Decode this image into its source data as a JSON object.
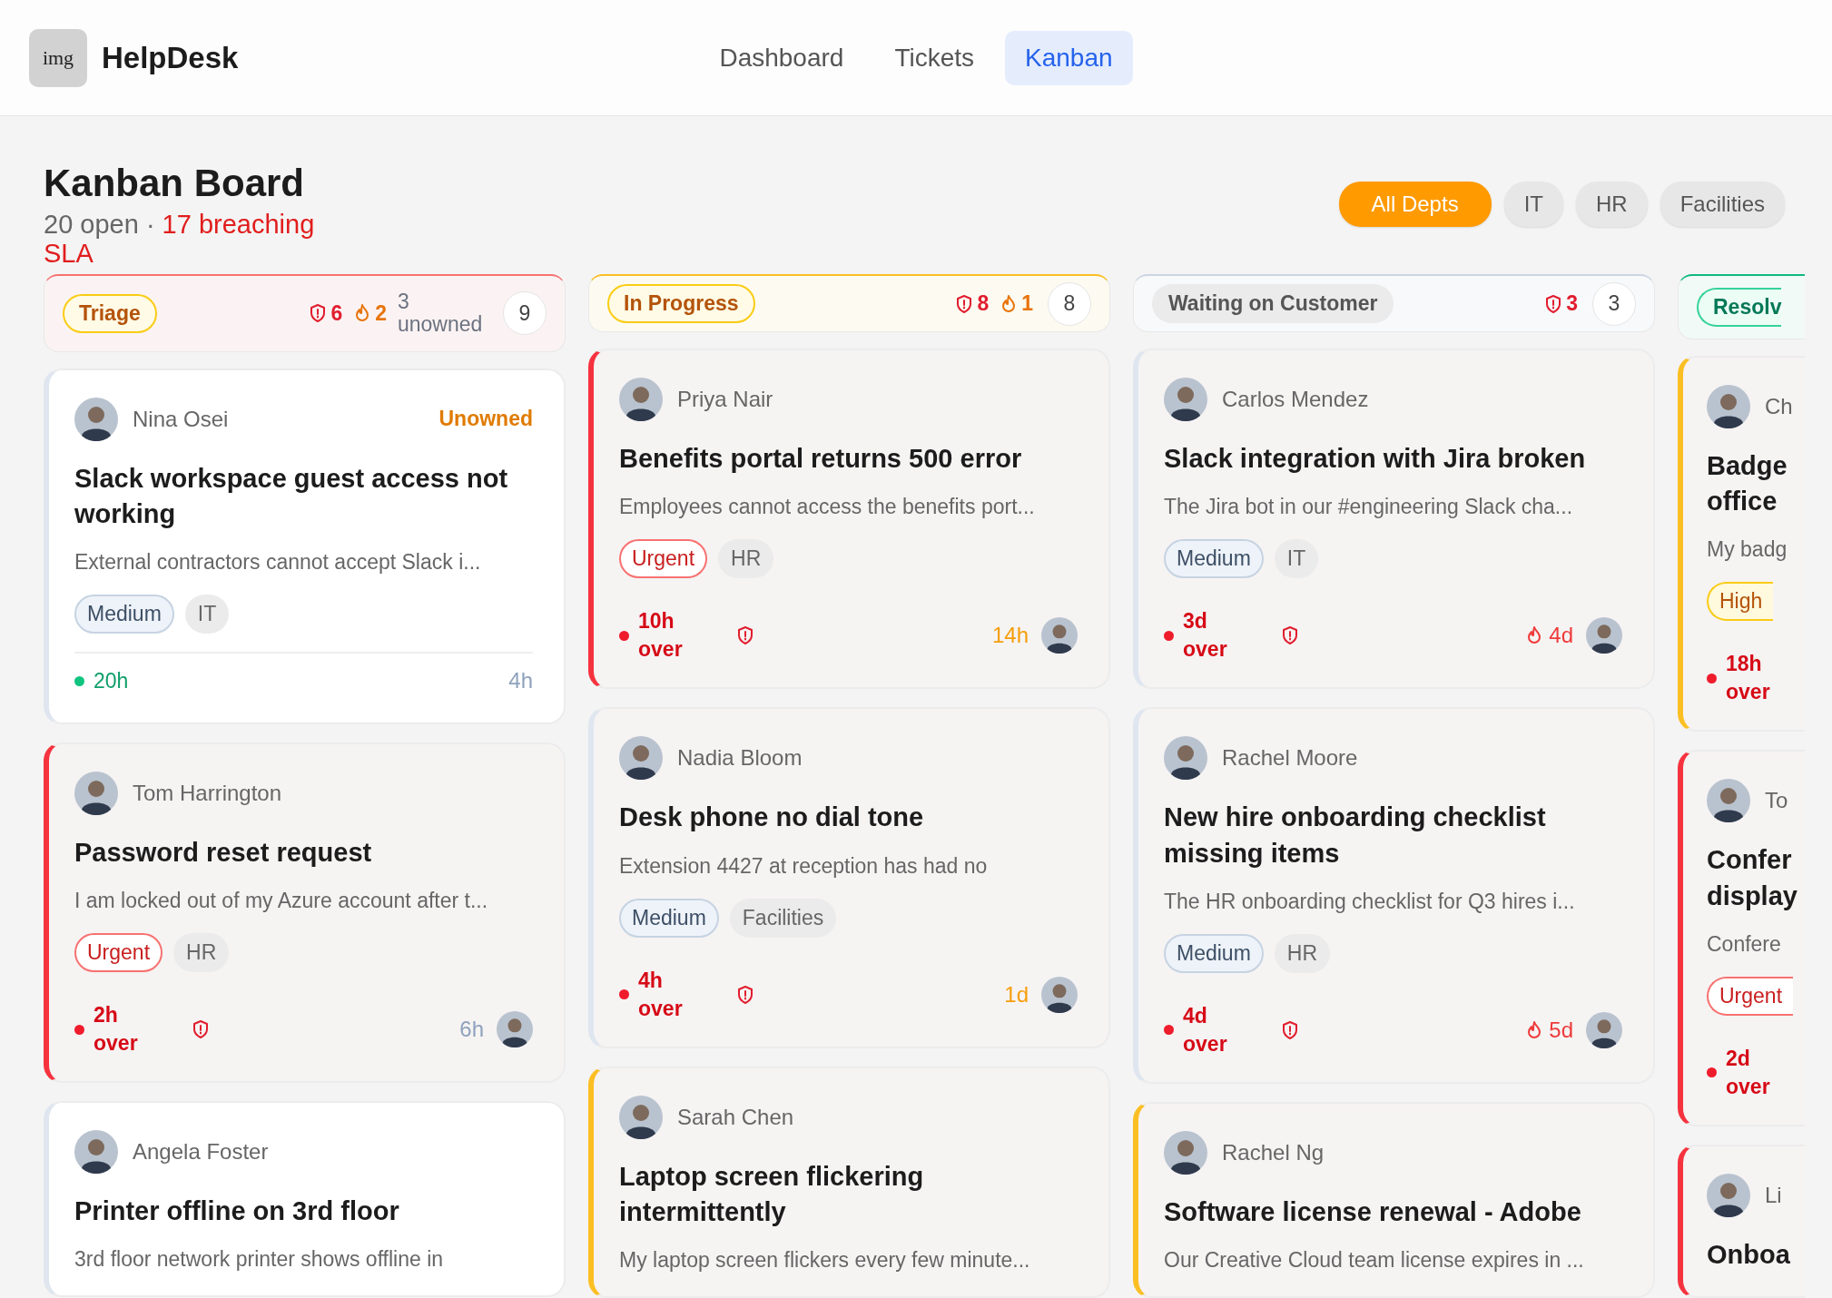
{
  "app": {
    "logo_text": "img",
    "name": "HelpDesk"
  },
  "nav": [
    {
      "label": "Dashboard",
      "selected": false
    },
    {
      "label": "Tickets",
      "selected": false
    },
    {
      "label": "Kanban",
      "selected": true
    }
  ],
  "page": {
    "title": "Kanban Board",
    "open": "20 open",
    "separator": "·",
    "breaching": "17 breaching SLA"
  },
  "filters": [
    {
      "label": "All Depts",
      "selected": true
    },
    {
      "label": "IT",
      "selected": false
    },
    {
      "label": "HR",
      "selected": false
    },
    {
      "label": "Facilities",
      "selected": false
    }
  ],
  "columns": [
    {
      "status": "Triage",
      "kind": "triage",
      "stats": [
        {
          "kind": "breach",
          "value": "6"
        },
        {
          "kind": "hot",
          "value": "2"
        },
        {
          "kind": "unowned",
          "value": "3 unowned"
        }
      ],
      "count": "9",
      "cards": [
        {
          "kind": "medium",
          "requester": "Nina Osei",
          "owner_note": "Unowned",
          "title": "Slack workspace guest access not working",
          "description": "External contractors cannot accept Slack i...",
          "tags": [
            {
              "label": "Medium",
              "kind": "medium"
            },
            {
              "label": "IT",
              "kind": "dept"
            }
          ],
          "breached": false,
          "sla": "20h",
          "flagged": false,
          "age": {
            "text": "4h",
            "kind": "normal"
          },
          "assigned": false
        },
        {
          "kind": "urgent",
          "requester": "Tom Harrington",
          "title": "Password reset request",
          "description": "I am locked out of my Azure account after t...",
          "tags": [
            {
              "label": "Urgent",
              "kind": "urgent"
            },
            {
              "label": "HR",
              "kind": "dept"
            }
          ],
          "breached": true,
          "sla": "2h over",
          "flagged": true,
          "age": {
            "text": "6h",
            "kind": "normal"
          },
          "assigned": true
        },
        {
          "kind": "medium",
          "requester": "Angela Foster",
          "title": "Printer offline on 3rd floor",
          "description": "3rd floor network printer shows offline in",
          "breached": false
        }
      ]
    },
    {
      "status": "In Progress",
      "kind": "progress",
      "stats": [
        {
          "kind": "breach",
          "value": "8"
        },
        {
          "kind": "hot",
          "value": "1"
        }
      ],
      "count": "8",
      "cards": [
        {
          "kind": "urgent",
          "requester": "Priya Nair",
          "title": "Benefits portal returns 500 error",
          "description": "Employees cannot access the benefits port...",
          "tags": [
            {
              "label": "Urgent",
              "kind": "urgent"
            },
            {
              "label": "HR",
              "kind": "dept"
            }
          ],
          "breached": true,
          "sla": "10h over",
          "flagged": true,
          "age": {
            "text": "14h",
            "kind": "warn"
          },
          "assigned": true
        },
        {
          "kind": "medium",
          "requester": "Nadia Bloom",
          "title": "Desk phone no dial tone",
          "description": "Extension 4427 at reception has had no",
          "tags": [
            {
              "label": "Medium",
              "kind": "medium"
            },
            {
              "label": "Facilities",
              "kind": "dept"
            }
          ],
          "breached": true,
          "sla": "4h over",
          "flagged": true,
          "age": {
            "text": "1d",
            "kind": "warn"
          },
          "assigned": true
        },
        {
          "kind": "high",
          "requester": "Sarah Chen",
          "title": "Laptop screen flickering intermittently",
          "description": "My laptop screen flickers every few minute...",
          "breached": true
        }
      ]
    },
    {
      "status": "Waiting on Customer",
      "kind": "waiting",
      "stats": [
        {
          "kind": "breach",
          "value": "3"
        }
      ],
      "count": "3",
      "cards": [
        {
          "kind": "medium",
          "requester": "Carlos Mendez",
          "title": "Slack integration with Jira broken",
          "description": "The Jira bot in our #engineering Slack cha...",
          "tags": [
            {
              "label": "Medium",
              "kind": "medium"
            },
            {
              "label": "IT",
              "kind": "dept"
            }
          ],
          "breached": true,
          "sla": "3d over",
          "flagged": true,
          "age": {
            "text": "4d",
            "kind": "hot"
          },
          "assigned": true
        },
        {
          "kind": "medium",
          "requester": "Rachel Moore",
          "title": "New hire onboarding checklist missing items",
          "description": "The HR onboarding checklist for Q3 hires i...",
          "tags": [
            {
              "label": "Medium",
              "kind": "medium"
            },
            {
              "label": "HR",
              "kind": "dept"
            }
          ],
          "breached": true,
          "sla": "4d over",
          "flagged": true,
          "age": {
            "text": "5d",
            "kind": "hot"
          },
          "assigned": true
        },
        {
          "kind": "high",
          "requester": "Rachel Ng",
          "title": "Software license renewal - Adobe",
          "description": "Our Creative Cloud team license expires in ...",
          "breached": true
        }
      ]
    },
    {
      "status": "Resolv",
      "kind": "resolved",
      "cards": [
        {
          "kind": "high",
          "requester": "Ch",
          "title": "Badge office",
          "description": "My badg",
          "tags": [
            {
              "label": "High",
              "kind": "high"
            }
          ],
          "breached": true,
          "sla": "18h over"
        },
        {
          "kind": "urgent",
          "requester": "To",
          "title": "Confer display",
          "description": "Confere",
          "tags": [
            {
              "label": "Urgent",
              "kind": "urgent"
            }
          ],
          "breached": true,
          "sla": "2d over"
        },
        {
          "kind": "urgent",
          "requester": "Li",
          "title": "Onboa",
          "breached": true
        }
      ]
    }
  ]
}
